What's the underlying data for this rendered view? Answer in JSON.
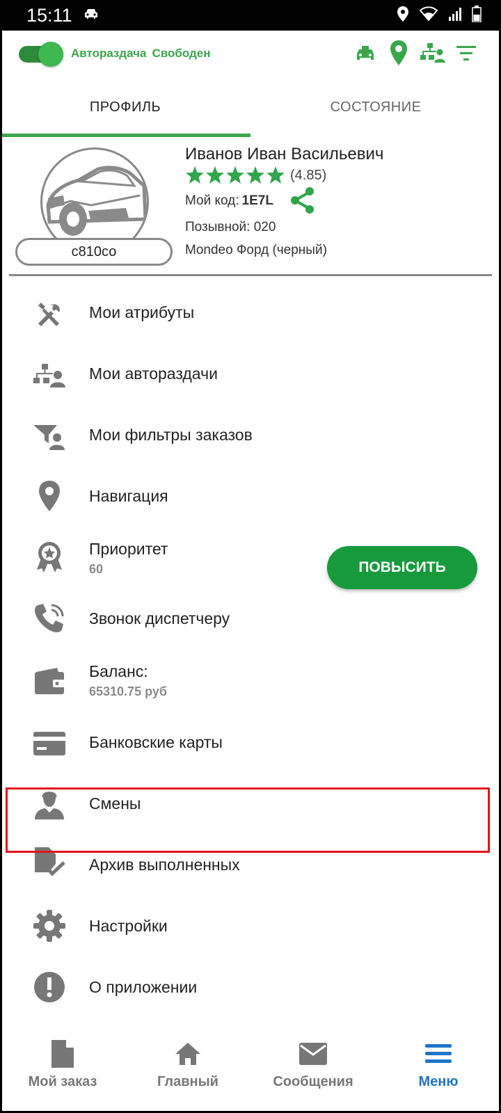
{
  "status_bar": {
    "time": "15:11",
    "left_icon": "car-icon",
    "right_icons": [
      "location-icon",
      "wifi-icon",
      "signal-icon",
      "battery-icon"
    ]
  },
  "topbar": {
    "auto_dispatch_label": "Авторaздача",
    "state_label": "Свободен",
    "toggle_on": true,
    "icons": [
      "taxi-icon",
      "map-pin-icon",
      "dispatch-tree-icon",
      "filter-icon"
    ],
    "accent_color": "#3aa64c"
  },
  "tabs": [
    {
      "label": "ПРОФИЛЬ",
      "active": true
    },
    {
      "label": "СОСТОЯНИЕ",
      "active": false
    }
  ],
  "profile": {
    "name": "Иванов Иван Васильевич",
    "stars": 5,
    "rating": "(4.85)",
    "code_label": "Мой код:",
    "code_value": "1E7L",
    "callsign": "Позывной: 020",
    "car": "Mondeo Форд (черный)",
    "plate": "с810со"
  },
  "menu": [
    {
      "label": "Мои атрибуты",
      "icon": "tools-icon"
    },
    {
      "label": "Мои автораздачи",
      "icon": "dispatch-user-icon"
    },
    {
      "label": "Мои фильтры заказов",
      "icon": "filter-user-icon"
    },
    {
      "label": "Навигация",
      "icon": "map-pin-icon"
    },
    {
      "label": "Приоритет",
      "sub": "60",
      "icon": "award-icon",
      "button": "ПОВЫСИТЬ"
    },
    {
      "label": "Звонок диспетчеру",
      "icon": "phone-ring-icon"
    },
    {
      "label": "Баланс:",
      "sub": "65310.75 руб",
      "icon": "wallet-icon"
    },
    {
      "label": "Банковские карты",
      "icon": "credit-card-icon"
    },
    {
      "label": "Смены",
      "icon": "driver-icon",
      "highlighted": true
    },
    {
      "label": "Архив выполненных",
      "icon": "archive-check-icon"
    },
    {
      "label": "Настройки",
      "icon": "gear-icon"
    },
    {
      "label": "О приложении",
      "icon": "info-icon"
    }
  ],
  "bottom_nav": [
    {
      "label": "Мой заказ",
      "icon": "document-icon",
      "active": false
    },
    {
      "label": "Главный",
      "icon": "home-icon",
      "active": false
    },
    {
      "label": "Сообщения",
      "icon": "envelope-icon",
      "active": false
    },
    {
      "label": "Меню",
      "icon": "menu-icon",
      "active": true
    }
  ]
}
